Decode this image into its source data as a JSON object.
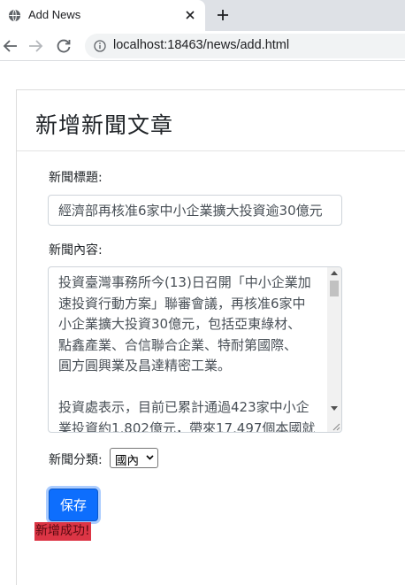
{
  "browser": {
    "tab_title": "Add News",
    "url": "localhost:18463/news/add.html"
  },
  "page": {
    "heading": "新增新聞文章",
    "title_label": "新聞標題:",
    "title_value": "經濟部再核准6家中小企業擴大投資逾30億元",
    "content_label": "新聞內容:",
    "content_value": "投資臺灣事務所今(13)日召開「中小企業加\n速投資行動方案」聯審會議，再核准6家中\n小企業擴大投資30億元，包括亞東綠材、\n點鑫產業、合信聯合企業、特耐第國際、\n圓方圓興業及昌達精密工業。\n\n投資處表示，目前已累計通過423家中小企\n業投資約1,802億元，帶來17,497個本國就",
    "category_label": "新聞分類:",
    "category_selected": "國內",
    "save_label": "保存",
    "success_message": "新增成功!"
  },
  "colors": {
    "primary": "#0d6efd",
    "danger": "#dc3545"
  }
}
